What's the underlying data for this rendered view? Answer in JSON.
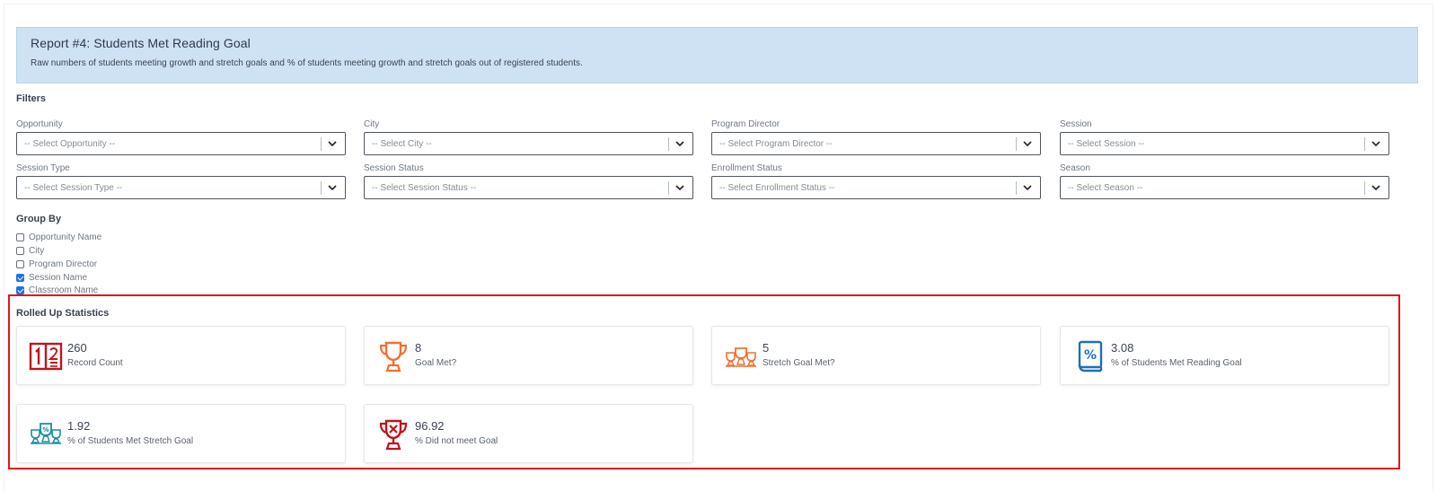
{
  "report": {
    "title": "Report #4: Students Met Reading Goal",
    "description": "Raw numbers of students meeting growth and stretch goals and % of students meeting growth and stretch goals out of registered students."
  },
  "filters": {
    "heading": "Filters",
    "opportunity": {
      "label": "Opportunity",
      "placeholder": "-- Select Opportunity --"
    },
    "city": {
      "label": "City",
      "placeholder": "-- Select City --"
    },
    "program_director": {
      "label": "Program Director",
      "placeholder": "-- Select Program Director --"
    },
    "session": {
      "label": "Session",
      "placeholder": "-- Select Session --"
    },
    "session_type": {
      "label": "Session Type",
      "placeholder": "-- Select Session Type --"
    },
    "session_status": {
      "label": "Session Status",
      "placeholder": "-- Select Session Status --"
    },
    "enrollment_status": {
      "label": "Enrollment Status",
      "placeholder": "-- Select Enrollment Status --"
    },
    "season": {
      "label": "Season",
      "placeholder": "-- Select Season --"
    }
  },
  "group_by": {
    "heading": "Group By",
    "items": [
      {
        "label": "Opportunity Name",
        "checked": false
      },
      {
        "label": "City",
        "checked": false
      },
      {
        "label": "Program Director",
        "checked": false
      },
      {
        "label": "Session Name",
        "checked": true
      },
      {
        "label": "Classroom Name",
        "checked": true
      }
    ]
  },
  "stats": {
    "heading": "Rolled Up Statistics",
    "cards": [
      {
        "value": "260",
        "label": "Record Count",
        "icon": "number-icon"
      },
      {
        "value": "8",
        "label": "Goal Met?",
        "icon": "trophy-icon"
      },
      {
        "value": "5",
        "label": "Stretch Goal Met?",
        "icon": "trophies-icon"
      },
      {
        "value": "3.08",
        "label": "% of Students Met Reading Goal",
        "icon": "percent-book-icon"
      },
      {
        "value": "1.92",
        "label": "% of Students Met Stretch Goal",
        "icon": "percent-trophies-icon"
      },
      {
        "value": "96.92",
        "label": "% Did not meet Goal",
        "icon": "trophy-x-icon"
      }
    ]
  },
  "colors": {
    "banner_bg": "#cfe2f3",
    "highlight_border": "#e3141c",
    "checkbox_checked": "#1a73e8",
    "icon_red": "#c0141c",
    "icon_orange": "#f07033",
    "icon_blue": "#1f6fb5",
    "icon_teal": "#1a8fa0"
  }
}
